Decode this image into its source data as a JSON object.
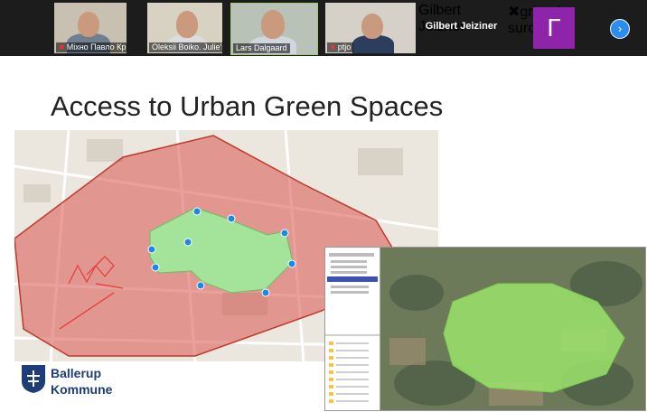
{
  "participants": [
    {
      "name": "Міхно Павло КрНУ",
      "muted": true
    },
    {
      "name": "Oleksii Boiko. Julie's Data",
      "muted": false
    },
    {
      "name": "Lars Dalgaard",
      "muted": false
    },
    {
      "name": "ptjo",
      "muted": true
    },
    {
      "name": "Gilbert Jeizner",
      "muted": false,
      "display_name": "Gilbert Jeiziner"
    },
    {
      "name": "grigoriy suroviy",
      "muted": true,
      "avatar_letter": "Г"
    }
  ],
  "next_icon": "chevron-right-icon",
  "slide": {
    "title": "Access to Urban Green Spaces",
    "logo_line1": "Ballerup",
    "logo_line2": "Kommune"
  },
  "colors": {
    "red_zone": "#d9534f",
    "green_zone": "#a4e39a",
    "avatar_purple": "#8e24aa",
    "brand_blue": "#1e3c78"
  }
}
